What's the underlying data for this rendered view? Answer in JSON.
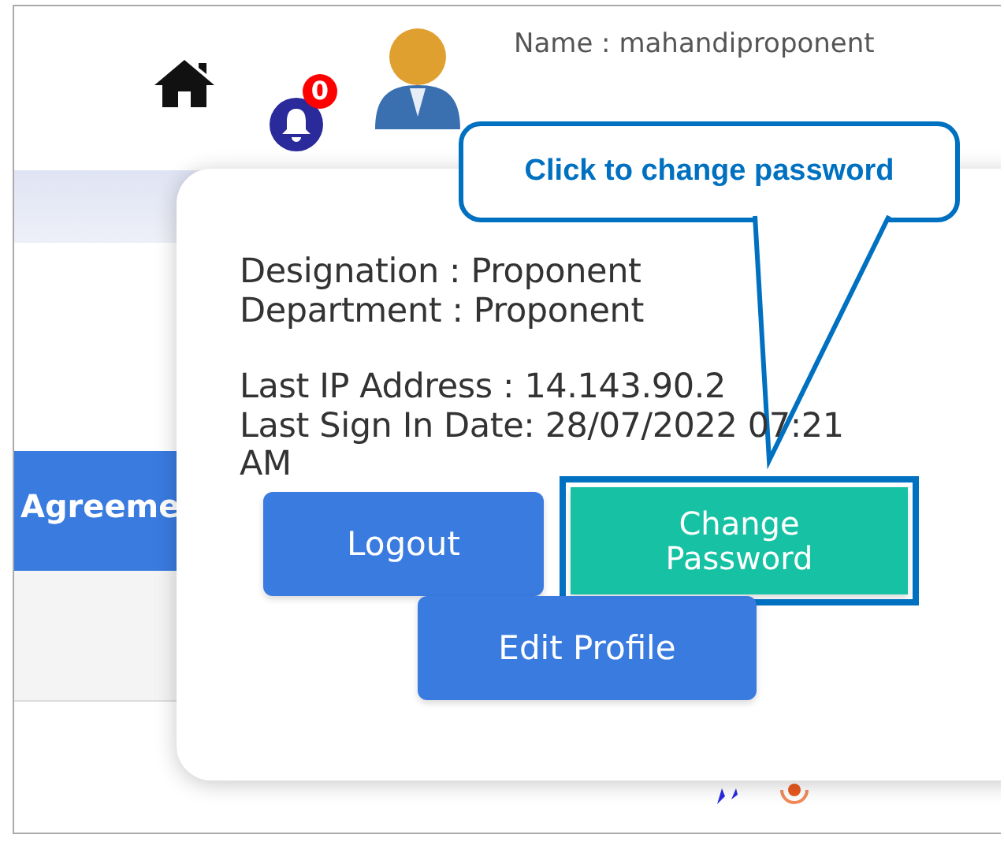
{
  "header": {
    "user_name": "Name : mahandiproponent",
    "notification_count": "0"
  },
  "nav_button": "Agreeme",
  "profile_popup": {
    "details": [
      {
        "text": "Designation : Proponent",
        "gap_before": false
      },
      {
        "text": "Department : Proponent",
        "gap_before": false
      },
      {
        "text": "Last IP Address : 14.143.90.2",
        "gap_before": true
      },
      {
        "text": "Last Sign In Date: 28/07/2022 07:21 AM",
        "gap_before": false
      }
    ],
    "buttons": [
      {
        "label": "Logout",
        "kind": "primary",
        "highlighted": false
      },
      {
        "label": "Change\nPassword",
        "kind": "success",
        "highlighted": true
      },
      {
        "label": "Edit Profile",
        "kind": "primary",
        "highlighted": false
      }
    ]
  },
  "callout": {
    "text": "Click to change password"
  }
}
